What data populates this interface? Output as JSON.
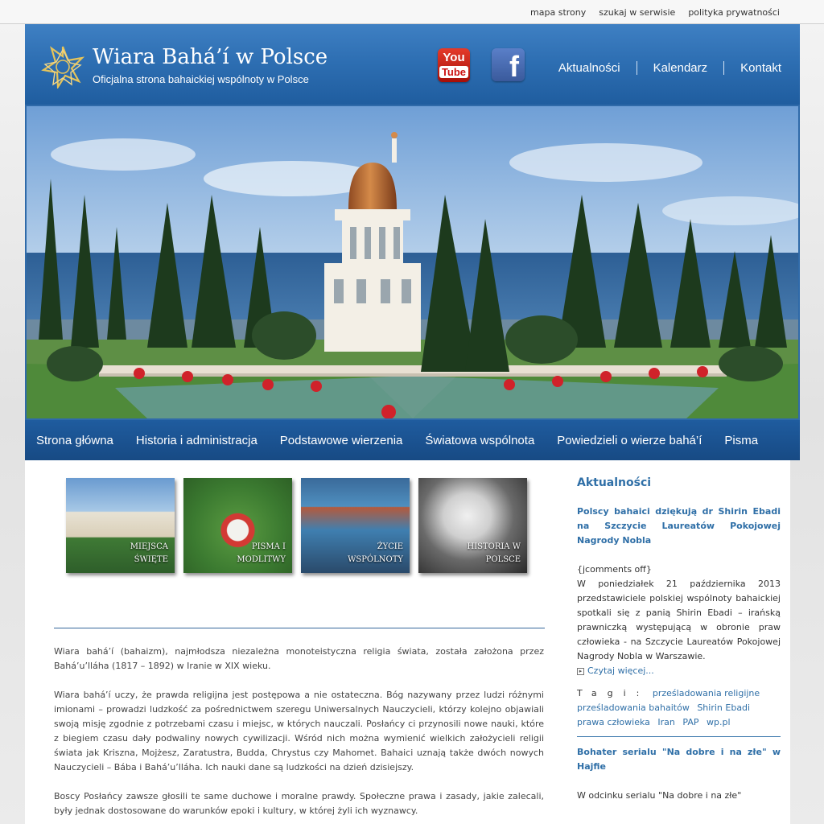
{
  "toplinks": [
    "mapa strony",
    "szukaj w serwisie",
    "polityka prywatności"
  ],
  "header": {
    "title": "Wiara Bahá’í w Polsce",
    "subtitle": "Oficjalna strona bahaickiej wspólnoty w Polsce",
    "youtube_top": "You",
    "youtube_bottom": "Tube",
    "facebook": "f",
    "nav": [
      "Aktualności",
      "Kalendarz",
      "Kontakt"
    ]
  },
  "main_nav": [
    "Strona główna",
    "Historia i administracja",
    "Podstawowe wierzenia",
    "Światowa wspólnota",
    "Powiedzieli o wierze bahá’í",
    "Pisma"
  ],
  "thumbnails": [
    {
      "label": "Miejsca święte"
    },
    {
      "label": "Pisma i modlitwy"
    },
    {
      "label": "Życie wspólnoty"
    },
    {
      "label": "Historia w Polsce"
    }
  ],
  "intro": [
    "Wiara bahá’í (bahaizm), najmłodsza niezależna monoteistyczna religia świata, została założona przez Bahá’u’lláha (1817 – 1892) w Iranie w XIX wieku.",
    "Wiara bahá’í uczy, że prawda religijna jest postępowa a nie ostateczna. Bóg nazywany przez ludzi różnymi imionami – prowadzi ludzkość za pośrednictwem szeregu Uniwersalnych Nauczycieli, którzy kolejno objawiali swoją misję zgodnie z potrzebami czasu i miejsc, w których nauczali. Posłańcy ci przynosili nowe nauki, które z biegiem czasu dały podwaliny nowych cywilizacji. Wśród nich można wymienić wielkich założycieli religii świata jak Kriszna, Mojżesz, Zaratustra, Budda, Chrystus czy Mahomet. Bahaici uznają także dwóch nowych Nauczycieli – Bába i Bahá’u’lláha. Ich nauki dane są ludzkości na dzień dzisiejszy.",
    "Boscy Posłańcy zawsze głosili te same duchowe i moralne prawdy. Społeczne prawa i zasady, jakie zalecali, były jednak dostosowane do warunków epoki i kultury, w której żyli ich wyznawcy."
  ],
  "sidebar": {
    "title": "Aktualności",
    "news1_title": "Polscy bahaici dziękują dr Shirin Ebadi na Szczycie Laureatów Pokojowej Nagrody Nobla",
    "news1_code": "{jcomments off}",
    "news1_body": "W poniedziałek 21 października 2013 przedstawiciele polskiej wspólnoty bahaickiej spotkali się z panią Shirin Ebadi – irańską prawniczką występującą w obronie praw człowieka - na Szczycie Laureatów Pokojowej Nagrody Nobla w Warszawie.",
    "read_more": "Czytaj więcej...",
    "tags_label": "Tagi:",
    "tags": [
      "prześladowania religijne",
      "prześladowania bahaitów",
      "Shirin Ebadi",
      "prawa człowieka",
      "Iran",
      "PAP",
      "wp.pl"
    ],
    "news2_title": "Bohater serialu \"Na dobre i na złe\" w Hajfie",
    "news2_body": "W odcinku serialu \"Na dobre i na złe\""
  }
}
